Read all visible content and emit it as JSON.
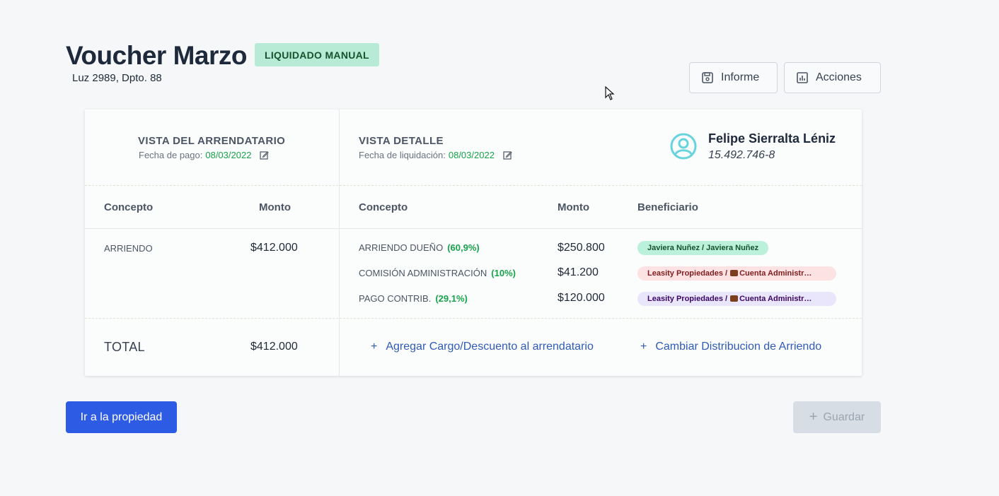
{
  "header": {
    "title": "Voucher Marzo",
    "status_badge": "LIQUIDADO MANUAL",
    "address": "Luz 2989, Dpto. 88",
    "buttons": {
      "informe": "Informe",
      "acciones": "Acciones"
    }
  },
  "tenant_view": {
    "title": "VISTA DEL ARRENDATARIO",
    "date_label": "Fecha de pago:",
    "date_value": "08/03/2022",
    "columns": {
      "concept": "Concepto",
      "amount": "Monto"
    },
    "rows": [
      {
        "concept": "ARRIENDO",
        "amount": "$412.000"
      }
    ],
    "total_label": "TOTAL",
    "total_amount": "$412.000"
  },
  "detail_view": {
    "title": "VISTA DETALLE",
    "date_label": "Fecha de liquidación:",
    "date_value": "08/03/2022",
    "columns": {
      "concept": "Concepto",
      "amount": "Monto",
      "beneficiary": "Beneficiario"
    },
    "rows": [
      {
        "concept": "ARRIENDO DUEÑO",
        "pct": "(60,9%)",
        "amount": "$250.800",
        "beneficiary": "Javiera Nuñez / Javiera Nuñez"
      },
      {
        "concept": "COMISIÓN ADMINISTRACIÓN",
        "pct": "(10%)",
        "amount": "$41.200",
        "beneficiary_prefix": "Leasity Propiedades /",
        "beneficiary_suffix": "Cuenta Administr…"
      },
      {
        "concept": "PAGO CONTRIB.",
        "pct": "(29,1%)",
        "amount": "$120.000",
        "beneficiary_prefix": "Leasity Propiedades /",
        "beneficiary_suffix": "Cuenta Administr…"
      }
    ],
    "add_charge_link": "Agregar Cargo/Descuento al arrendatario",
    "change_distribution_link": "Cambiar Distribucion de Arriendo"
  },
  "person": {
    "name": "Felipe Sierralta Léniz",
    "rut": "15.492.746-8"
  },
  "footer": {
    "go_to_property": "Ir a la propiedad",
    "save": "Guardar"
  },
  "colors": {
    "accent": "#2d5be3",
    "success": "#16a34a",
    "badge_bg": "#b7ebd6",
    "link": "#2f5bb7"
  },
  "icons": {
    "informe": "floppy-disk-icon",
    "acciones": "bar-chart-icon",
    "edit": "edit-icon",
    "person": "user-circle-icon",
    "plus": "plus-icon"
  }
}
